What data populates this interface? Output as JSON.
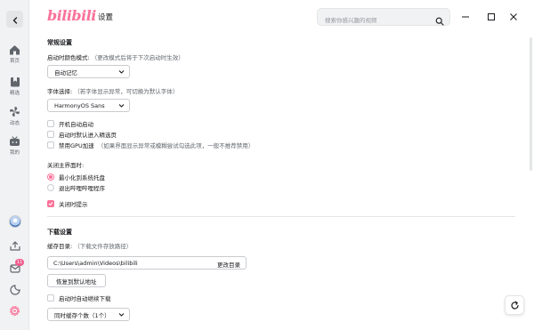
{
  "header": {
    "logo_text": "bilibili",
    "page_title": "设置",
    "search_placeholder": "搜索你感兴趣的视频"
  },
  "sidebar": {
    "items": [
      {
        "label": "首页",
        "icon": "home-icon"
      },
      {
        "label": "精选",
        "icon": "bookmark-icon"
      },
      {
        "label": "动态",
        "icon": "pinwheel-icon"
      },
      {
        "label": "我的",
        "icon": "tv-icon"
      }
    ],
    "message_badge": "11"
  },
  "general": {
    "title": "常规设置",
    "color_mode_label": "启动时颜色模式:",
    "color_mode_hint": "（更改模式后将于下次启动时生效）",
    "color_mode_value": "自动记忆",
    "font_label": "字体选择:",
    "font_hint": "（若字体显示异常，可切换为默认字体）",
    "font_value": "HarmonyOS Sans",
    "checks": [
      {
        "label": "开机自动启动",
        "checked": false
      },
      {
        "label": "启动时默认进入精选页",
        "checked": false
      },
      {
        "label": "禁用GPU加速",
        "hint": "（如果界面显示异常或模糊尝试勾选此项，一般不推荐禁用）",
        "checked": false
      }
    ],
    "close_label": "关闭主界面时:",
    "close_options": [
      {
        "label": "最小化到系统托盘",
        "selected": true
      },
      {
        "label": "退出哔哩哔哩程序",
        "selected": false
      }
    ],
    "close_tip_label": "关闭时提示",
    "close_tip_checked": true
  },
  "download": {
    "title": "下载设置",
    "cache_label": "缓存目录:",
    "cache_hint": "（下载文件存放路径）",
    "cache_path": "C:\\Users\\admin\\Videos\\bilibili",
    "change_dir": "更改目录",
    "reset_button": "恢复到默认地址",
    "auto_resume_label": "启动时自动继续下载",
    "auto_resume_checked": false,
    "concurrent_value": "同时缓存个数（1个）"
  },
  "colors": {
    "accent": "#fb7299",
    "text": "#18191c",
    "hint": "#61666d"
  }
}
